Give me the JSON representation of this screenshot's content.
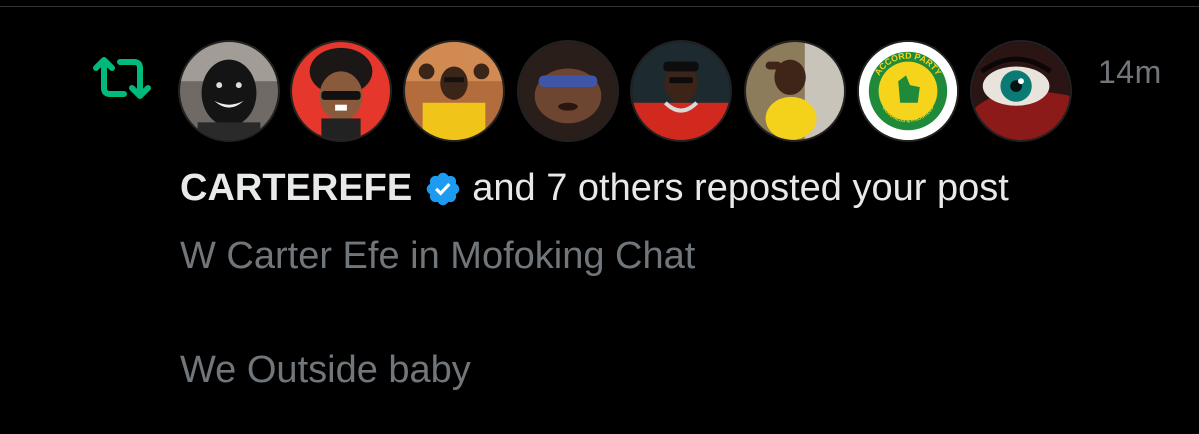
{
  "notification": {
    "type_icon": "repost-icon",
    "timestamp": "14m",
    "user_name": "CARTEREFE",
    "verified_icon": "verified-badge-icon",
    "action_text": "and 7 others reposted your post",
    "post_preview": {
      "line1": "W Carter Efe in Mofoking Chat",
      "line2": "We Outside baby"
    },
    "avatars": [
      {
        "label": "avatar-1"
      },
      {
        "label": "avatar-2"
      },
      {
        "label": "avatar-3"
      },
      {
        "label": "avatar-4"
      },
      {
        "label": "avatar-5"
      },
      {
        "label": "avatar-6"
      },
      {
        "label": "avatar-7",
        "badge_text": "ACCORD PARTY",
        "badge_subtext": "GOODNESS & PROGRESS"
      },
      {
        "label": "avatar-8"
      }
    ]
  },
  "colors": {
    "background": "#000000",
    "repost_green": "#00ba7c",
    "verified_blue": "#1d9bf0",
    "primary_text": "#e7e9ea",
    "secondary_text": "#71767b"
  }
}
